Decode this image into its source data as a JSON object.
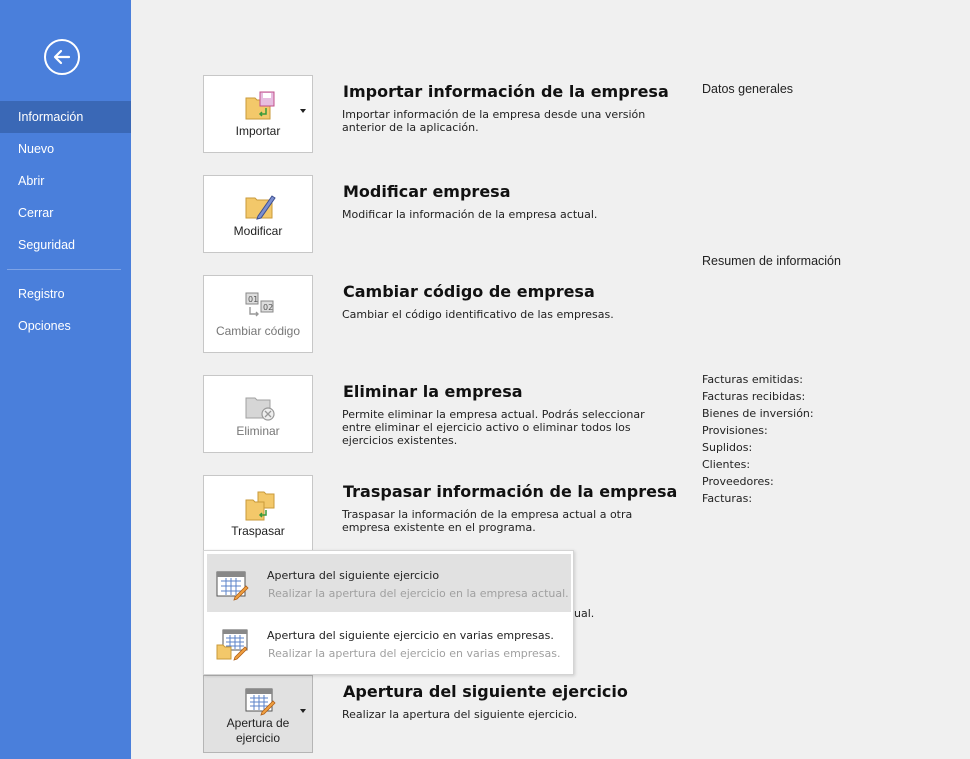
{
  "sidebar": {
    "items": [
      {
        "label": "Información",
        "active": true
      },
      {
        "label": "Nuevo"
      },
      {
        "label": "Abrir"
      },
      {
        "label": "Cerrar"
      },
      {
        "label": "Seguridad"
      },
      {
        "label": "Registro"
      },
      {
        "label": "Opciones"
      }
    ]
  },
  "sections": {
    "importar": {
      "button": "Importar",
      "title": "Importar información de la empresa",
      "desc": "Importar información de la empresa desde una versión anterior de la aplicación."
    },
    "modificar": {
      "button": "Modificar",
      "title": "Modificar empresa",
      "desc": "Modificar la información de la empresa actual."
    },
    "cambiar": {
      "button": "Cambiar código",
      "title": "Cambiar código de empresa",
      "desc": "Cambiar el código identificativo de las empresas."
    },
    "eliminar": {
      "button": "Eliminar",
      "title": "Eliminar la empresa",
      "desc": "Permite eliminar la empresa actual. Podrás seleccionar entre eliminar el ejercicio activo o eliminar todos los ejercicios existentes."
    },
    "traspasar": {
      "button": "Traspasar",
      "title": "Traspasar información de la empresa",
      "desc": "Traspasar la información de la empresa actual a otra empresa existente en el programa."
    },
    "apertura": {
      "button_line1": "Apertura de",
      "button_line2": "ejercicio",
      "title": "Apertura del siguiente ejercicio",
      "desc": "Realizar la apertura del siguiente ejercicio."
    }
  },
  "popup": {
    "items": [
      {
        "title": "Apertura del siguiente ejercicio",
        "desc": "Realizar la apertura del ejercicio en la empresa actual."
      },
      {
        "title": "Apertura del siguiente ejercicio en varias empresas.",
        "desc": "Realizar la apertura del ejercicio en varias empresas."
      }
    ],
    "hidden_text_fragment": "ual."
  },
  "right_panel": {
    "general_heading": "Datos generales",
    "summary_heading": "Resumen de información",
    "stats": [
      "Facturas emitidas:",
      "Facturas recibidas:",
      "Bienes de inversión:",
      "Provisiones:",
      "Suplidos:",
      "Clientes:",
      "Proveedores:",
      "Facturas:"
    ]
  },
  "colors": {
    "sidebar": "#4a7fdb",
    "sidebar_active": "#3a68b6",
    "background": "#f0f0f0",
    "folder": "#f3c86a",
    "accent_pink": "#c0508a",
    "accent_green": "#3a9a3a"
  },
  "icons": {
    "back": "back-arrow-icon",
    "importar": "folder-import-icon",
    "modificar": "folder-edit-icon",
    "cambiar": "change-code-icon",
    "eliminar": "folder-delete-icon",
    "traspasar": "folder-transfer-icon",
    "apertura": "calendar-edit-icon"
  }
}
